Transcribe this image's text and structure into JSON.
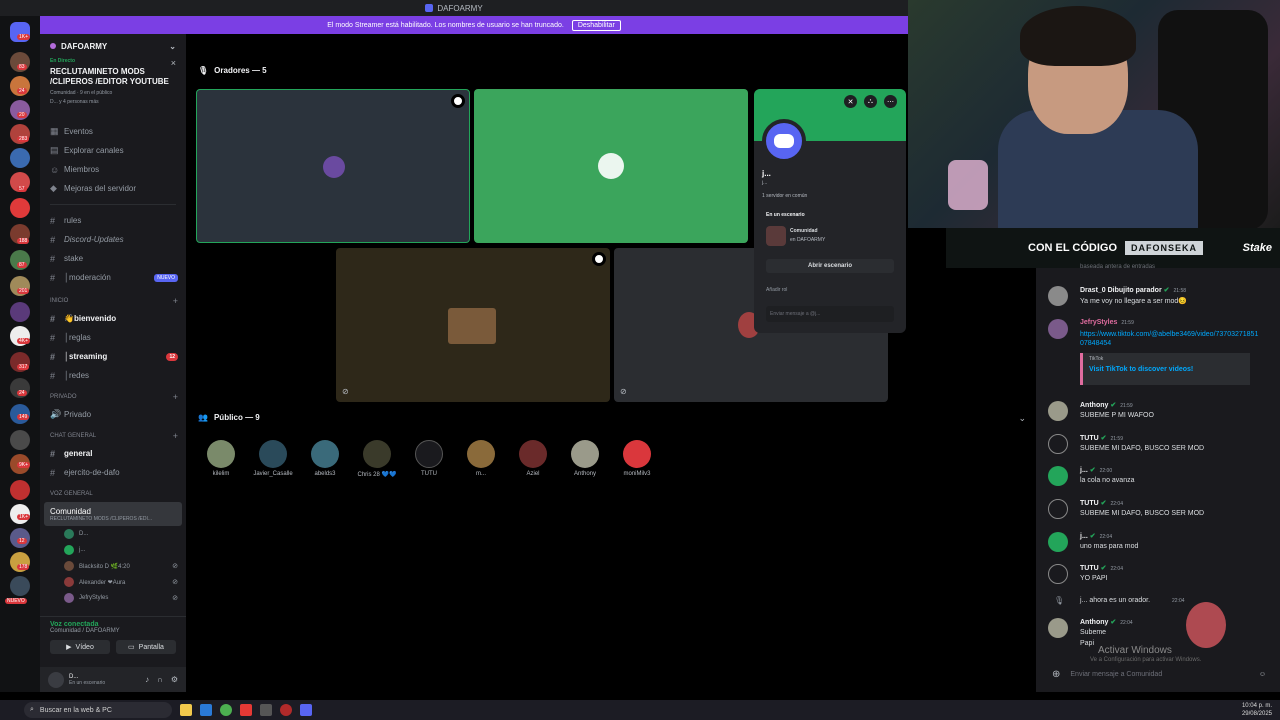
{
  "window": {
    "title": "DAFOARMY"
  },
  "streamer_banner": {
    "text": "El modo Streamer está habilitado. Los nombres de usuario se han truncado.",
    "button": "Deshabilitar"
  },
  "rail_badges": [
    "1K+",
    "83",
    "24",
    "20",
    "283",
    "57",
    "188",
    "87",
    "201",
    "4K+",
    "317",
    "24",
    "149",
    "9K+",
    "1K+",
    "12",
    "178"
  ],
  "rail_new": "NUEVO",
  "sidebar": {
    "server_name": "DAFOARMY",
    "event": {
      "status": "En Directo",
      "title": "RECLUTAMINETO MODS /CLIPEROS /EDITOR YOUTUBE",
      "meta": "Comunidad · 9 en el público",
      "meta2": "D... y 4 personas más"
    },
    "nav": [
      "Eventos",
      "Explorar canales",
      "Miembros",
      "Mejoras del servidor"
    ],
    "channels_top": [
      {
        "icon": "#",
        "name": "rules"
      },
      {
        "icon": "#",
        "name": "Discord-Updates"
      },
      {
        "icon": "#",
        "name": "stake"
      },
      {
        "icon": "#",
        "name": "│moderación",
        "badge": "NUEVO"
      }
    ],
    "cat_inicio": "INICIO",
    "channels_inicio": [
      {
        "icon": "#",
        "name": "👋bienvenido",
        "bold": true
      },
      {
        "icon": "#",
        "name": "│reglas"
      },
      {
        "icon": "#",
        "name": "│streaming",
        "bold": true,
        "count": "12"
      },
      {
        "icon": "#",
        "name": "│redes"
      }
    ],
    "cat_privado": "PRIVADO",
    "channels_privado": [
      {
        "icon": "🔊",
        "name": "Privado"
      }
    ],
    "cat_chat": "CHAT GENERAL",
    "channels_chat": [
      {
        "icon": "#",
        "name": "general",
        "bold": true
      },
      {
        "icon": "#",
        "name": "ejercito-de-dafo"
      }
    ],
    "cat_voz": "VOZ GENERAL",
    "stage_channel": {
      "name": "Comunidad",
      "sub": "RECLUTAMINETO MODS /CLIPEROS /EDI..."
    },
    "voice_users": [
      "D...",
      "j...",
      "Blacksito D  🌿4:20",
      "Alexander  ❤Aura",
      "JefryStyles"
    ]
  },
  "voice_panel": {
    "status": "Voz conectada",
    "location": "Comunidad / DAFOARMY",
    "video": "Vídeo",
    "screen": "Pantalla"
  },
  "user_panel": {
    "name": "D...",
    "status": "En un escenario"
  },
  "stage": {
    "speakers_label": "Oradores — 5",
    "audience_label": "Público — 9",
    "audience": [
      "kilelim",
      "Javier_Casalle",
      "abelds3",
      "Chris 28 💙💙",
      "TUTU",
      "m...",
      "Aziel",
      "Anthony",
      "moniMilv3"
    ]
  },
  "popup": {
    "name": "j...",
    "sub": "j...",
    "mutual": "1 servidor en común",
    "section": "En un escenario",
    "stage_name": "Comunidad",
    "stage_server": "en DAFOARMY",
    "open_button": "Abrir escenario",
    "add_role": "Añadir rol",
    "message_placeholder": "Enviar mensaje a @j..."
  },
  "promo": {
    "text": "CON EL CÓDIGO",
    "code": "DAFONSEKA",
    "brand": "Stake"
  },
  "chat": {
    "top_cut": "baseada antera de entradas",
    "messages": [
      {
        "user": "Drast_0 Dibujito parador",
        "time": "21:58",
        "text": "Ya me voy no llegare a ser mod😣",
        "color": "#f2f3f5"
      },
      {
        "user": "JefryStyles",
        "time": "21:59",
        "text": "https://www.tiktok.com/@abelbe3469/video/7370327185107848454",
        "color": "#e06c9f"
      },
      {
        "user": "Anthony",
        "time": "21:59",
        "text": "SUBEME P MI WAFOO",
        "color": "#f2f3f5"
      },
      {
        "user": "TUTU",
        "time": "21:59",
        "text": "SUBEME MI DAFO, BUSCO SER MOD",
        "color": "#f2f3f5"
      },
      {
        "user": "j...",
        "time": "22:00",
        "text": "la cola no avanza",
        "color": "#f2f3f5"
      },
      {
        "user": "TUTU",
        "time": "22:04",
        "text": "SUBEME MI DAFO, BUSCO SER MOD",
        "color": "#f2f3f5"
      },
      {
        "user": "j...",
        "time": "22:04",
        "text": "uno mas para mod",
        "color": "#f2f3f5"
      },
      {
        "user": "TUTU",
        "time": "22:04",
        "text": "YO PAPI",
        "color": "#f2f3f5"
      },
      {
        "user": "Anthony",
        "time": "22:04",
        "text": "Subeme",
        "color": "#f2f3f5"
      }
    ],
    "embed_site": "TikTok",
    "embed_title": "Visit TikTok to discover videos!",
    "system_msg": "j... ahora es un orador.",
    "system_time": "22:04",
    "last_extra": "Papi",
    "input_placeholder": "Enviar mensaje a Comunidad"
  },
  "windows_activate": {
    "title": "Activar Windows",
    "sub": "Ve a Configuración para activar Windows."
  },
  "taskbar": {
    "search": "Buscar en la web & PC",
    "time": "10:04 p. m.",
    "date": "29/08/2025"
  }
}
